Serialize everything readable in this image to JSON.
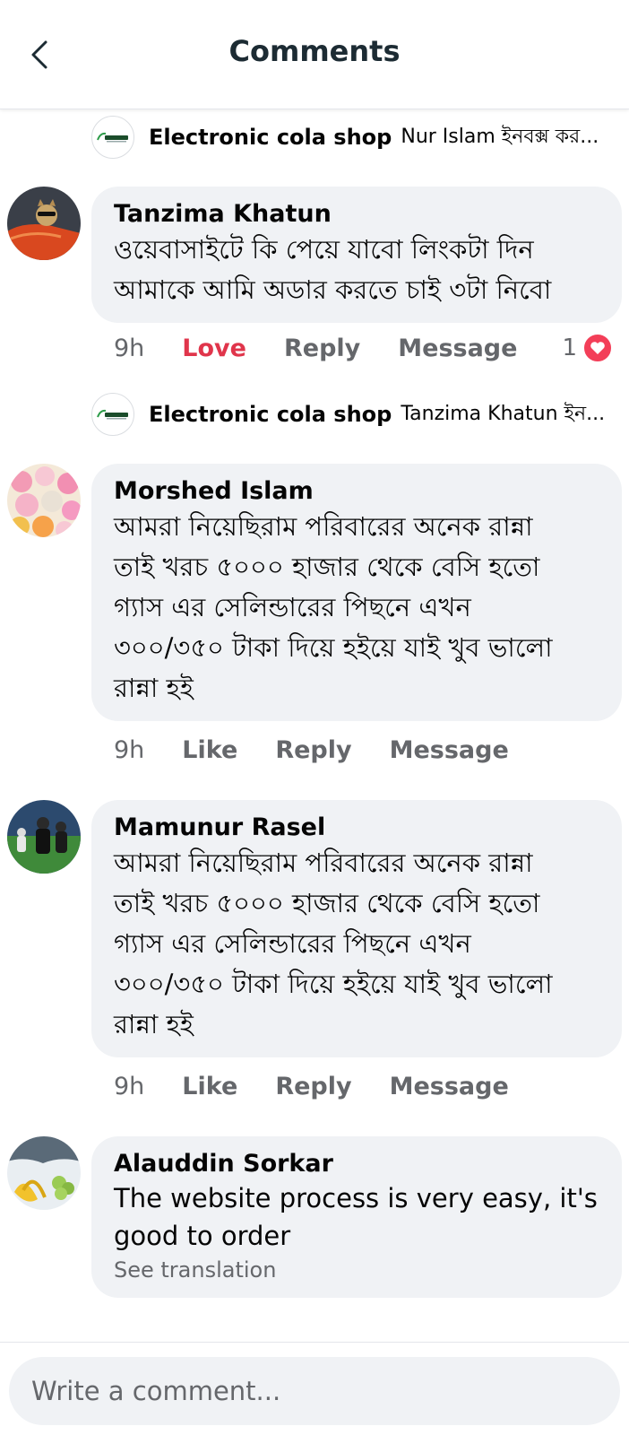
{
  "header": {
    "title": "Comments"
  },
  "threads": [
    {
      "reply_preview": {
        "page_name": "Electronic cola shop",
        "text": "Nur Islam ইনবক্স কর..."
      },
      "comment": {
        "author": "Tanzima Khatun",
        "text_lines": [
          "ওয়েবাসাইটে কি পেয়ে যাবো লিংকটা দিন",
          "আমাকে আমি অডার করতে চাই ৩টা নিবো"
        ],
        "time": "9h",
        "reaction_action": "Love",
        "reply": "Reply",
        "message": "Message",
        "reaction_count": "1"
      }
    },
    {
      "reply_preview": {
        "page_name": "Electronic cola shop",
        "text": "Tanzima Khatun ইন..."
      },
      "comment": {
        "author": "Morshed Islam",
        "text_lines": [
          "আমরা নিয়েছিরাম পরিবারের অনেক রান্না",
          "তাই খরচ ৫০০০ হাজার থেকে বেসি হতো",
          "গ্যাস এর সেলিন্ডারের পিছনে এখন",
          "৩০০/৩৫০ টাকা দিয়ে হইয়ে যাই খুব ভালো",
          "রান্না হই"
        ],
        "time": "9h",
        "reaction_action": "Like",
        "reply": "Reply",
        "message": "Message"
      }
    },
    {
      "comment": {
        "author": "Mamunur Rasel",
        "text_lines": [
          "আমরা নিয়েছিরাম পরিবারের অনেক রান্না",
          "তাই খরচ ৫০০০ হাজার থেকে বেসি হতো",
          "গ্যাস এর সেলিন্ডারের পিছনে এখন",
          "৩০০/৩৫০ টাকা দিয়ে হইয়ে যাই খুব ভালো",
          "রান্না হই"
        ],
        "time": "9h",
        "reaction_action": "Like",
        "reply": "Reply",
        "message": "Message"
      }
    },
    {
      "comment": {
        "author": "Alauddin Sorkar",
        "text_lines": [
          "The website process is very easy, it's",
          "good to order"
        ],
        "see_translation": "See translation"
      }
    }
  ],
  "composer": {
    "placeholder": "Write a comment..."
  },
  "colors": {
    "bubble": "#f0f2f5",
    "love": "#e0354b",
    "secondary_text": "#65676b",
    "heart": "#f33e58"
  },
  "icons": {
    "back": "chevron-left-icon",
    "reaction": "heart-icon"
  }
}
